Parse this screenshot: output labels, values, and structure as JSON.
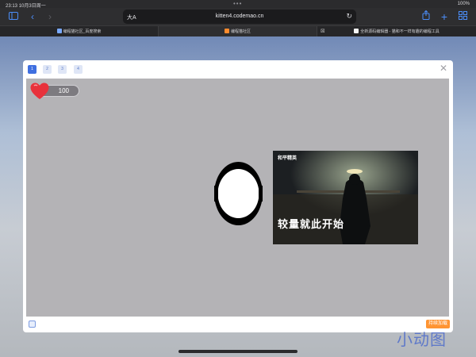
{
  "status_bar": {
    "time": "23:13",
    "date": "10月3日周一",
    "dots": "•••",
    "battery": "100%"
  },
  "toolbar": {
    "sidebar_icon": "sidebar-icon",
    "back_icon": "chevron-left-icon",
    "forward_icon": "chevron-right-icon",
    "aa_label": "大A",
    "host": "kitten4.codemao.cn",
    "share_icon": "share-icon",
    "new_tab_icon": "plus-icon",
    "tabs_icon": "tabs-overview-icon"
  },
  "tabs": [
    {
      "title": "编程猫社区_百度搜索"
    },
    {
      "title": "编程猫社区"
    },
    {
      "title": "全新源码编辑器 - 猫和不一样有趣的编程工具"
    }
  ],
  "dialog": {
    "pages": [
      "1",
      "2",
      "3",
      "4"
    ],
    "active_page": 0,
    "close_label": "✕",
    "hp_value": "100",
    "badge_label": "持续加载"
  },
  "poster": {
    "logo": "和平精英",
    "tagline": "较量就此开始"
  },
  "watermark": "小动图",
  "colors": {
    "accent": "#3f6fe0",
    "stage": "#b4b3b6",
    "badge": "#ff9432",
    "heart": "#e8323c"
  }
}
